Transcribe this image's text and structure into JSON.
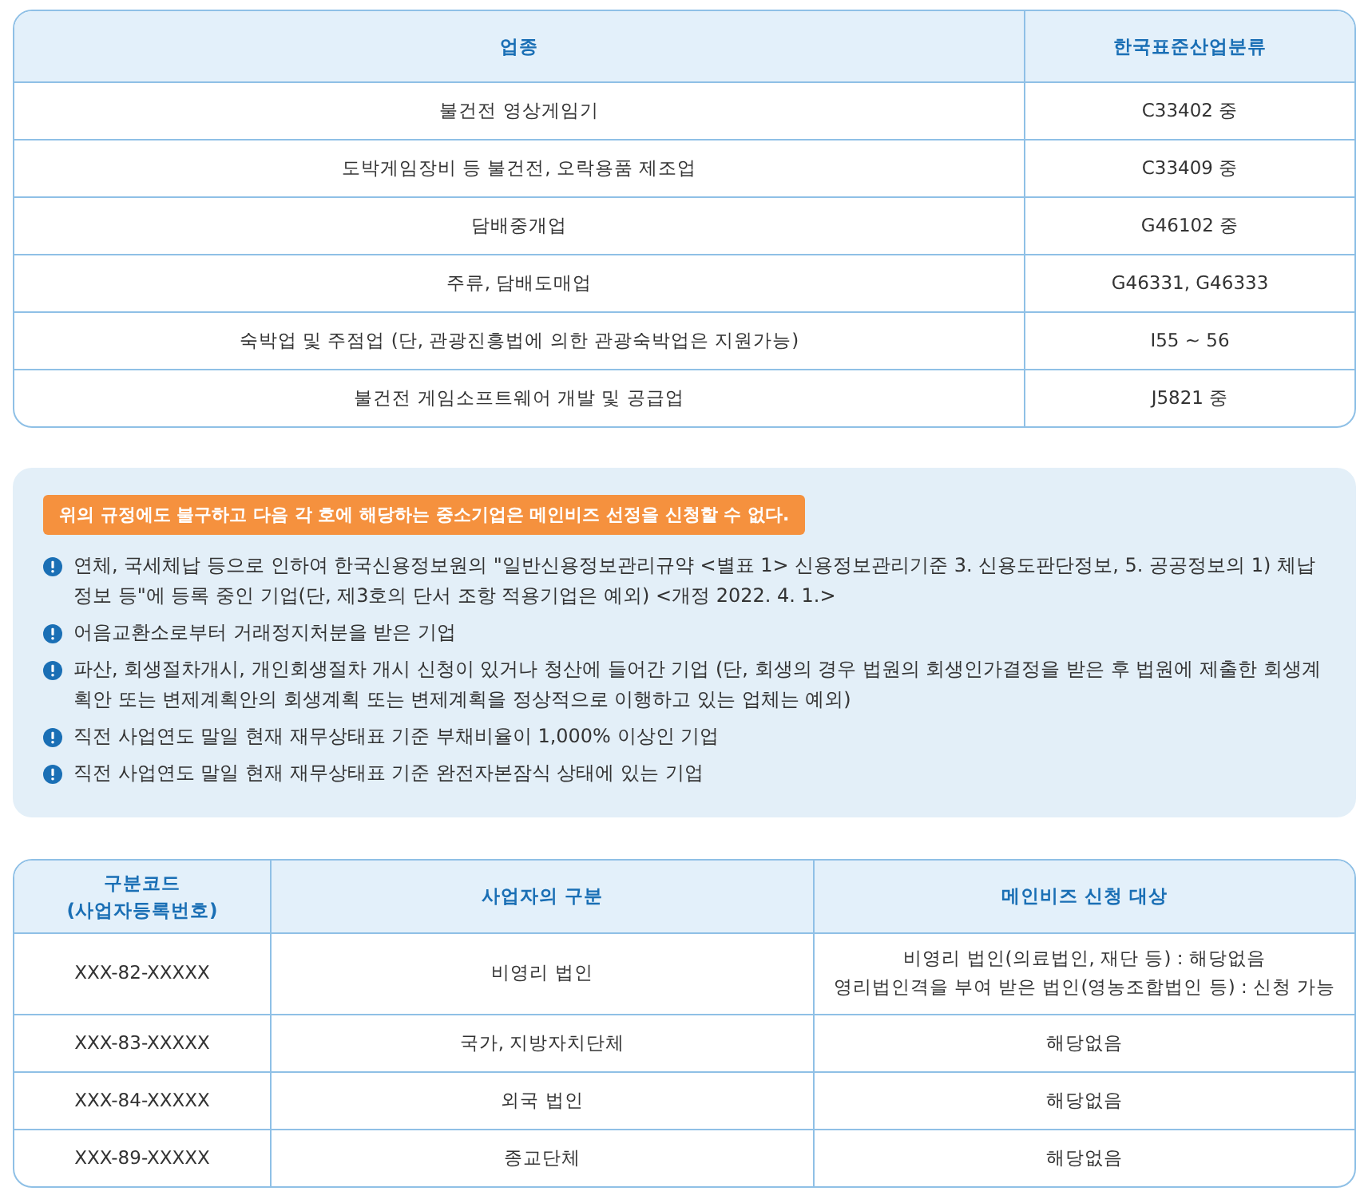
{
  "industry_table": {
    "columns": [
      "업종",
      "한국표준산업분류"
    ],
    "rows": [
      [
        "불건전 영상게임기",
        "C33402 중"
      ],
      [
        "도박게임장비 등 불건전, 오락용품 제조업",
        "C33409 중"
      ],
      [
        "담배중개업",
        "G46102 중"
      ],
      [
        "주류, 담배도매업",
        "G46331, G46333"
      ],
      [
        "숙박업 및 주점업 (단, 관광진흥법에 의한 관광숙박업은 지원가능)",
        "I55 ~ 56"
      ],
      [
        "불건전 게임소프트웨어 개발 및 공급업",
        "J5821 중"
      ]
    ]
  },
  "notice": {
    "title": "위의 규정에도 불구하고 다음 각 호에 해당하는 중소기업은 메인비즈 선정을 신청할 수 없다.",
    "items": [
      "연체, 국세체납 등으로 인하여 한국신용정보원의 \"일반신용정보관리규약 <별표 1> 신용정보관리기준 3. 신용도판단정보, 5. 공공정보의 1) 체납정보 등\"에 등록 중인 기업(단, 제3호의 단서 조항 적용기업은 예외) <개정 2022. 4. 1.>",
      "어음교환소로부터 거래정지처분을 받은 기업",
      "파산, 회생절차개시, 개인회생절차 개시 신청이 있거나 청산에 들어간 기업 (단, 회생의 경우 법원의 회생인가결정을 받은 후 법원에 제출한 회생계획안 또는 변제계획안의 회생계획 또는 변제계획을 정상적으로 이행하고 있는 업체는 예외)",
      "직전 사업연도 말일 현재 재무상태표 기준 부채비율이 1,000% 이상인 기업",
      "직전 사업연도 말일 현재 재무상태표 기준 완전자본잠식 상태에 있는 기업"
    ]
  },
  "business_table": {
    "columns": [
      "구분코드\n(사업자등록번호)",
      "사업자의 구분",
      "메인비즈 신청 대상"
    ],
    "rows": [
      [
        "XXX-82-XXXXX",
        "비영리 법인",
        "비영리 법인(의료법인, 재단 등) : 해당없음\n영리법인격을 부여 받은 법인(영농조합법인 등) : 신청 가능"
      ],
      [
        "XXX-83-XXXXX",
        "국가, 지방자치단체",
        "해당없음"
      ],
      [
        "XXX-84-XXXXX",
        "외국 법인",
        "해당없음"
      ],
      [
        "XXX-89-XXXXX",
        "종교단체",
        "해당없음"
      ]
    ]
  }
}
